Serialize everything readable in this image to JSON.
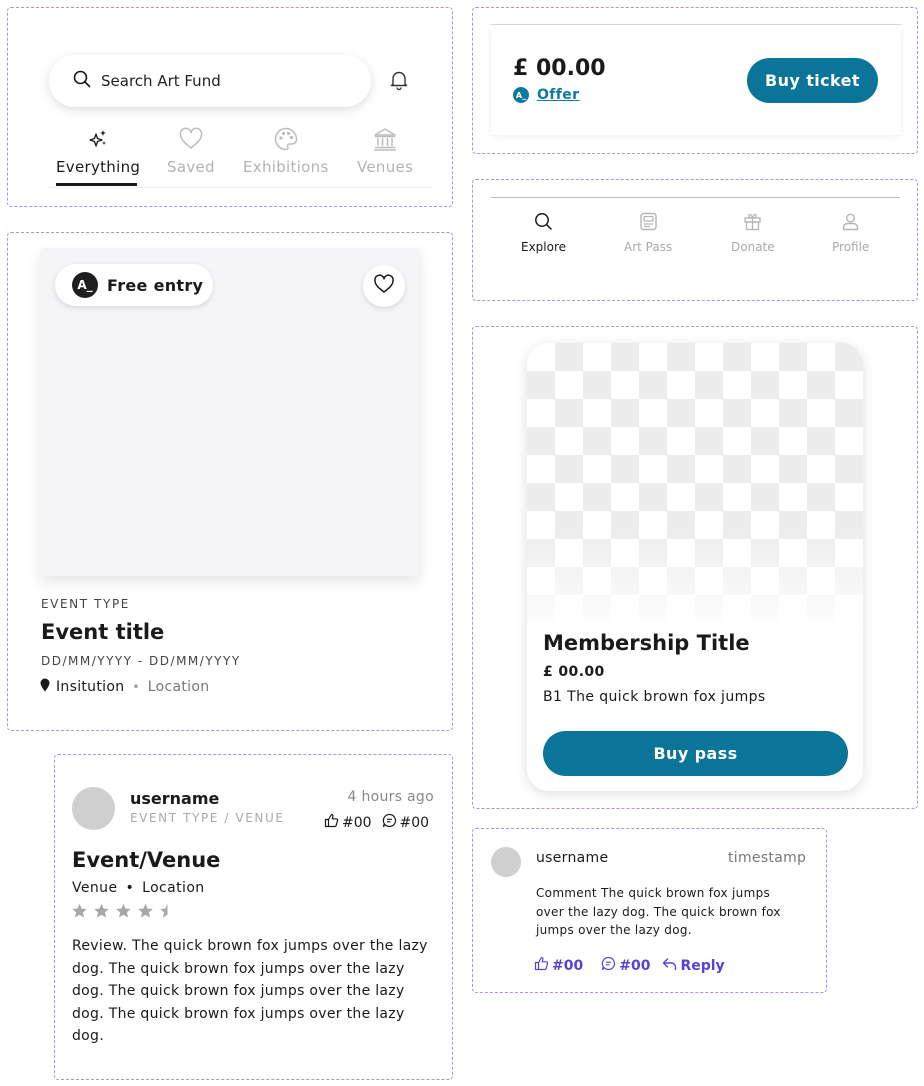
{
  "search": {
    "placeholder": "Search Art Fund"
  },
  "filter_tabs": [
    {
      "label": "Everything",
      "icon": "sparkles-icon",
      "active": true
    },
    {
      "label": "Saved",
      "icon": "heart-icon",
      "active": false
    },
    {
      "label": "Exhibitions",
      "icon": "palette-icon",
      "active": false
    },
    {
      "label": "Venues",
      "icon": "museum-icon",
      "active": false
    }
  ],
  "event_card": {
    "badge_letter": "A_",
    "badge_label": "Free entry",
    "event_type": "EVENT TYPE",
    "title": "Event title",
    "dates": "DD/MM/YYYY - DD/MM/YYYY",
    "institution": "Insitution",
    "location": "Location"
  },
  "review_card": {
    "username": "username",
    "subtitle": "EVENT TYPE / VENUE",
    "time": "4 hours ago",
    "likes": "#00",
    "comments": "#00",
    "title": "Event/Venue",
    "venue": "Venue",
    "location": "Location",
    "rating": 4.5,
    "rating_color": "#a8a8a8",
    "body": "Review. The quick brown fox jumps over the lazy dog. The quick brown fox jumps over the lazy dog. The quick brown fox jumps over the lazy dog. The quick brown fox jumps over the lazy dog."
  },
  "price_bar": {
    "price": "£ 00.00",
    "offer_badge": "A_",
    "offer_label": "Offer",
    "button_label": "Buy ticket",
    "accent": "#0b7499"
  },
  "bottom_nav": [
    {
      "label": "Explore",
      "icon": "search-icon",
      "active": true
    },
    {
      "label": "Art Pass",
      "icon": "card-icon",
      "active": false
    },
    {
      "label": "Donate",
      "icon": "gift-icon",
      "active": false
    },
    {
      "label": "Profile",
      "icon": "user-icon",
      "active": false
    }
  ],
  "membership_card": {
    "title": "Membership Title",
    "price": "£ 00.00",
    "description": "B1 The quick brown fox jumps",
    "button_label": "Buy pass"
  },
  "comment_card": {
    "username": "username",
    "timestamp": "timestamp",
    "body": "Comment The quick brown fox jumps over the lazy dog. The quick brown fox jumps over the lazy dog.",
    "likes": "#00",
    "comments": "#00",
    "reply_label": "Reply",
    "accent": "#5a3fd9"
  }
}
